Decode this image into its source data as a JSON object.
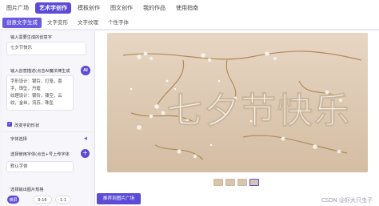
{
  "topnav": {
    "items": [
      {
        "label": "图片广场"
      },
      {
        "label": "艺术字创作"
      },
      {
        "label": "模板创作"
      },
      {
        "label": "图文创作"
      },
      {
        "label": "我的作品"
      },
      {
        "label": "使用指南"
      }
    ]
  },
  "subnav": {
    "items": [
      {
        "label": "创意文字生成"
      },
      {
        "label": "文字变形"
      },
      {
        "label": "文字纹理"
      },
      {
        "label": "个性字体"
      }
    ]
  },
  "left": {
    "text_label": "输入需要生成的创意字",
    "text_value": "七夕节快乐",
    "prompt_label": "输入创意描述(点击AI魔法棒生成",
    "prompt_value": "字形设计：银铃，灯笼，喜字，珠坠，丹霞\n纹理设计：银铃，镂空，云纹，金丝，流苏，珠坠",
    "ai_label": "AI",
    "checkbox_label": "改变字的形状",
    "font_section_label": "字体选择",
    "font_pick_label": "选择使用字体(点击+号上传字体",
    "font_value": "默认字体",
    "size_label": "选择输出图片规格",
    "sizes": [
      {
        "label": "横屏"
      },
      {
        "label": "9:16"
      },
      {
        "label": "1:1"
      }
    ]
  },
  "right": {
    "publish_label": "推荐到图片广场",
    "watermark": "CSDN @好大只虫子"
  },
  "artwork": {
    "text": "七夕节快乐"
  }
}
